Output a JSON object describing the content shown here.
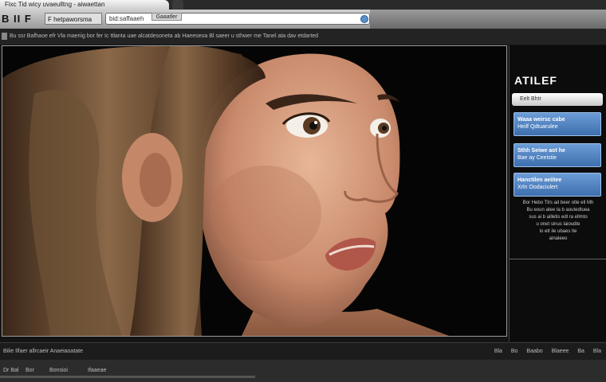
{
  "browser": {
    "tab_title": "Fixc Tid wicy uvaeulltng - aiwaettan",
    "toolbar_logo": "B II F",
    "site_label": "F hetpaworsma",
    "address": "bid:saffaaeh",
    "address_chip": "Gaaatler",
    "bookmarks": "Bu ssr Bafhaoe efr Vla maeriig bor fer Ic ttlanta uae alcatdesoneta ab Haeeseoa  Bl saeer u sthwer me Tanel ata dav etdarted"
  },
  "sidebar": {
    "title": "ATILEF",
    "search": "Eelt  Bhtr",
    "cards": [
      {
        "line1": "Waaa weirsc cabe",
        "line2": "Heilf Qdtuarulee"
      },
      {
        "line1": "Sthh Seiwe aot he",
        "line2": "Bae ay Ceeistie"
      },
      {
        "line1": "Hanctilen aeiitee",
        "line2": "Xrln Oodaciulert"
      }
    ],
    "text_lines": [
      "Bor Hebo Ttrs ad beer otte ell Mh",
      "Bu eoun atee ta b aoutedtuea",
      "sus ai b ailletis edl ra ellmto",
      "u onet sinus laioudte",
      "lo ett ile ubaes tle",
      "ainaleeo"
    ]
  },
  "status": {
    "left": "Bilie  Ilfaer allrcaeir Anaeiaoatate",
    "controls": [
      "Bla",
      "Bo",
      "Baabo",
      "Blaeee",
      "Ba",
      "Bla"
    ]
  },
  "bottom": {
    "items": [
      "Dr Bal",
      "Bor",
      "Bonsioi",
      "Ifaaeae"
    ]
  },
  "colors": {
    "card_top": "#6b9cd6",
    "card_bottom": "#3e6fae",
    "background": "#141414"
  }
}
